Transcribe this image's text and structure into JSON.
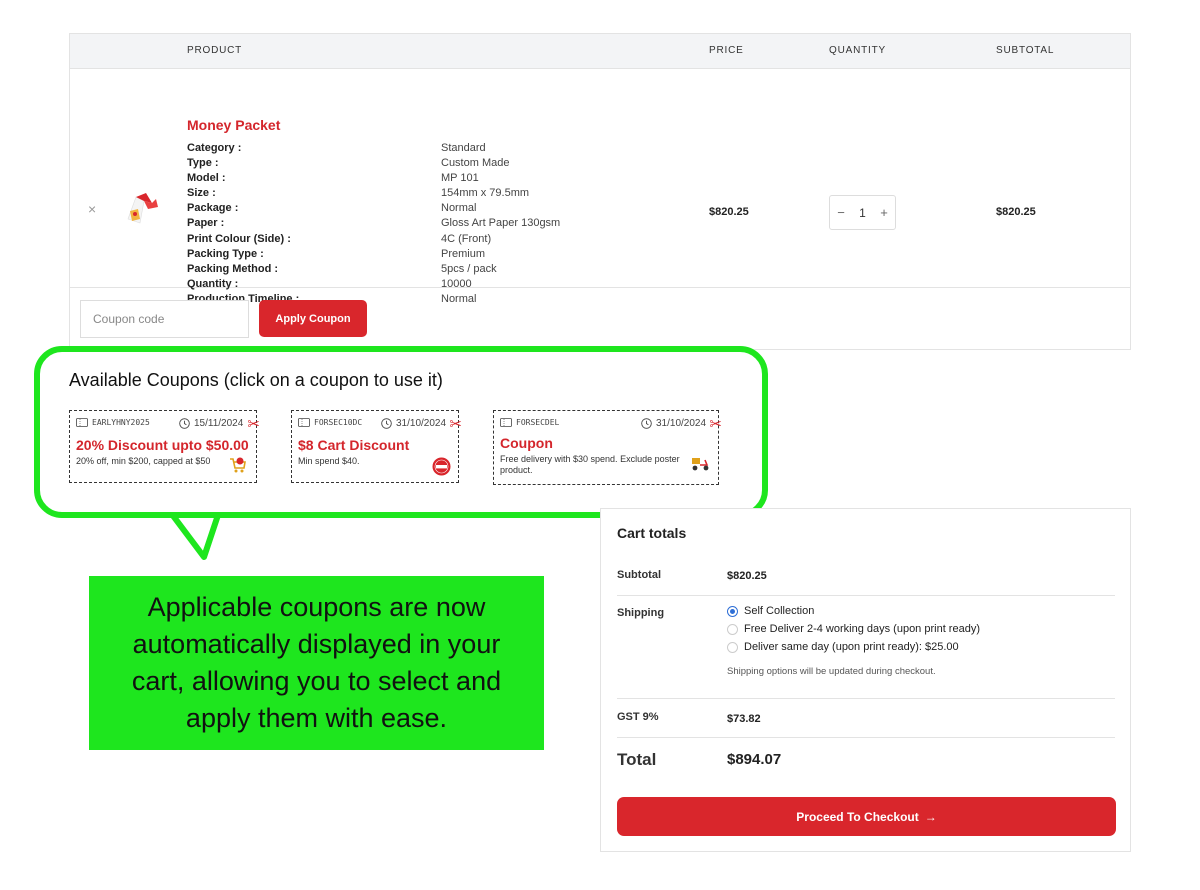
{
  "cart": {
    "headers": {
      "product": "PRODUCT",
      "price": "PRICE",
      "quantity": "QUANTITY",
      "subtotal": "SUBTOTAL"
    },
    "item": {
      "remove_label": "×",
      "name": "Money Packet",
      "specs": [
        {
          "key": "Category :",
          "value": "Standard"
        },
        {
          "key": "Type :",
          "value": "Custom Made"
        },
        {
          "key": "Model :",
          "value": "MP 101"
        },
        {
          "key": "Size :",
          "value": "154mm x 79.5mm"
        },
        {
          "key": "Package :",
          "value": "Normal"
        },
        {
          "key": "Paper :",
          "value": "Gloss Art Paper 130gsm"
        },
        {
          "key": "Print Colour (Side) :",
          "value": "4C (Front)"
        },
        {
          "key": "Packing Type :",
          "value": "Premium"
        },
        {
          "key": "Packing Method :",
          "value": "5pcs / pack"
        },
        {
          "key": "Quantity :",
          "value": "10000"
        },
        {
          "key": "Production Timeline :",
          "value": "Normal"
        }
      ],
      "price": "$820.25",
      "quantity": "1",
      "minus": "−",
      "plus": "+",
      "subtotal": "$820.25"
    },
    "coupon_placeholder": "Coupon code",
    "apply_label": "Apply Coupon"
  },
  "coupons": {
    "title": "Available Coupons (click on a coupon to use it)",
    "items": [
      {
        "code": "EARLYHNY2025",
        "date": "15/11/2024",
        "title": "20% Discount upto $50.00",
        "desc": "20% off, min $200, capped at $50",
        "icon": "shopping-cart-icon"
      },
      {
        "code": "FORSEC10DC",
        "date": "31/10/2024",
        "title": "$8 Cart Discount",
        "desc": "Min spend $40.",
        "icon": "sale-tag-icon"
      },
      {
        "code": "FORSECDEL",
        "date": "31/10/2024",
        "title": "Coupon",
        "desc": "Free delivery with $30 spend. Exclude poster product.",
        "icon": "delivery-scooter-icon"
      }
    ]
  },
  "callout_message": "Applicable coupons are now automatically displayed in your cart, allowing you to select and apply them with ease.",
  "totals": {
    "title": "Cart totals",
    "subtotal_label": "Subtotal",
    "subtotal_value": "$820.25",
    "shipping_label": "Shipping",
    "shipping_options": [
      {
        "label": "Self Collection",
        "selected": true
      },
      {
        "label": "Free Deliver 2-4 working days (upon print ready)",
        "selected": false
      },
      {
        "label": "Deliver same day (upon print ready): $25.00",
        "selected": false
      }
    ],
    "shipping_note": "Shipping options will be updated during checkout.",
    "gst_label": "GST 9%",
    "gst_value": "$73.82",
    "total_label": "Total",
    "total_value": "$894.07",
    "checkout_label": "Proceed To Checkout",
    "checkout_arrow": "→"
  },
  "colors": {
    "accent": "#d9262c",
    "highlight_green": "#1ee61e",
    "radio_blue": "#2f6fd6"
  }
}
